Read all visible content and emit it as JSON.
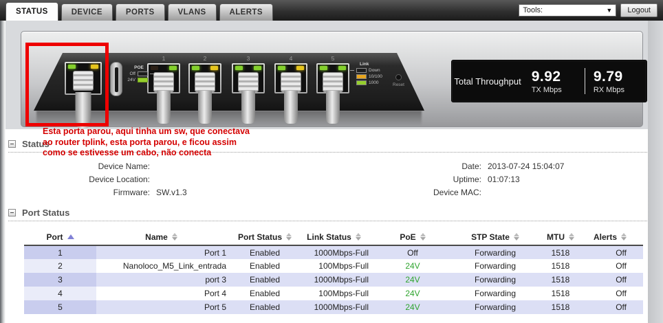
{
  "app": {
    "tabs": [
      {
        "label": "STATUS",
        "active": true
      },
      {
        "label": "DEVICE",
        "active": false
      },
      {
        "label": "PORTS",
        "active": false
      },
      {
        "label": "VLANS",
        "active": false
      },
      {
        "label": "ALERTS",
        "active": false
      }
    ],
    "tools_label": "Tools:",
    "logout_label": "Logout"
  },
  "device_graphic": {
    "ports": [
      {
        "label": "",
        "leds": [
          "green",
          "yellow"
        ],
        "highlighted": true
      },
      {
        "label": "1",
        "leds": [
          "off",
          "green"
        ],
        "highlighted": false
      },
      {
        "label": "2",
        "leds": [
          "green",
          "yellow"
        ],
        "highlighted": false
      },
      {
        "label": "3",
        "leds": [
          "green",
          "green"
        ],
        "highlighted": false
      },
      {
        "label": "4",
        "leds": [
          "green",
          "yellow"
        ],
        "highlighted": false
      },
      {
        "label": "5",
        "leds": [
          "green",
          "green"
        ],
        "highlighted": false
      }
    ],
    "poe_legend": {
      "title": "POE",
      "off_label": "Off",
      "on_label": "24V"
    },
    "link_legend": {
      "title": "Link",
      "items": [
        {
          "label": "Down",
          "color": "none"
        },
        {
          "label": "10/100",
          "color": "#e8a51e"
        },
        {
          "label": "1000",
          "color": "#96cf2c"
        }
      ]
    },
    "reset_label": "Reset"
  },
  "throughput": {
    "title": "Total Throughput",
    "tx": {
      "value": "9.92",
      "label": "TX Mbps"
    },
    "rx": {
      "value": "9.79",
      "label": "RX Mbps"
    }
  },
  "annotation": {
    "color": "#d40000",
    "lines": [
      "Esta porta parou, aqui tinha um sw, que conectava",
      "ao router tplink, esta porta parou, e ficou assim",
      "como se estivesse um cabo, não conecta"
    ]
  },
  "status_section": {
    "title": "Status",
    "fields_left": [
      {
        "label": "Device Name:",
        "value": ""
      },
      {
        "label": "Device Location:",
        "value": ""
      },
      {
        "label": "Firmware:",
        "value": "SW.v1.3"
      }
    ],
    "fields_right": [
      {
        "label": "Date:",
        "value": "2013-07-24 15:04:07"
      },
      {
        "label": "Uptime:",
        "value": "01:07:13"
      },
      {
        "label": "Device MAC:",
        "value": ""
      }
    ]
  },
  "port_status_section": {
    "title": "Port Status",
    "columns": [
      {
        "label": "Port",
        "sort": "asc"
      },
      {
        "label": "Name",
        "sort": "both"
      },
      {
        "label": "Port Status",
        "sort": "both"
      },
      {
        "label": "Link Status",
        "sort": "both"
      },
      {
        "label": "PoE",
        "sort": "both"
      },
      {
        "label": "STP State",
        "sort": "both"
      },
      {
        "label": "MTU",
        "sort": "both"
      },
      {
        "label": "Alerts",
        "sort": "both"
      }
    ],
    "rows": [
      {
        "port": "1",
        "name": "Port 1",
        "port_status": "Enabled",
        "link_status": "1000Mbps-Full",
        "poe": "Off",
        "stp_state": "Forwarding",
        "mtu": "1518",
        "alerts": "Off"
      },
      {
        "port": "2",
        "name": "Nanoloco_M5_Link_entrada",
        "port_status": "Enabled",
        "link_status": "100Mbps-Full",
        "poe": "24V",
        "stp_state": "Forwarding",
        "mtu": "1518",
        "alerts": "Off"
      },
      {
        "port": "3",
        "name": "port 3",
        "port_status": "Enabled",
        "link_status": "1000Mbps-Full",
        "poe": "24V",
        "stp_state": "Forwarding",
        "mtu": "1518",
        "alerts": "Off"
      },
      {
        "port": "4",
        "name": "Port 4",
        "port_status": "Enabled",
        "link_status": "100Mbps-Full",
        "poe": "24V",
        "stp_state": "Forwarding",
        "mtu": "1518",
        "alerts": "Off"
      },
      {
        "port": "5",
        "name": "Port 5",
        "port_status": "Enabled",
        "link_status": "1000Mbps-Full",
        "poe": "24V",
        "stp_state": "Forwarding",
        "mtu": "1518",
        "alerts": "Off"
      }
    ]
  },
  "colors": {
    "poe_on_green": "#2fa42f",
    "annotation_red": "#d40000",
    "highlight_red": "#ee0000",
    "sort_active": "#8181d6"
  }
}
